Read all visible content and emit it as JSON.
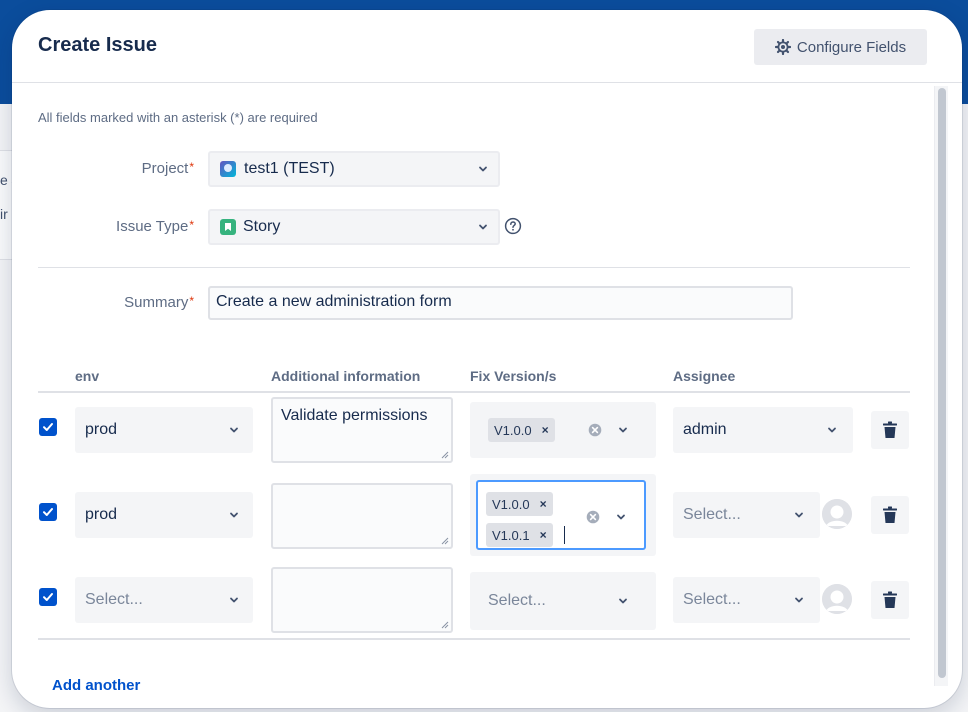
{
  "background": {
    "letter_1": "e J",
    "letter_2": "ir"
  },
  "modal": {
    "title": "Create Issue",
    "configure_label": "Configure Fields",
    "required_note": "All fields marked with an asterisk (*) are required"
  },
  "fields": {
    "project": {
      "label": "Project",
      "value": "test1 (TEST)"
    },
    "issue_type": {
      "label": "Issue Type",
      "value": "Story"
    },
    "summary": {
      "label": "Summary",
      "value": "Create a new administration form"
    },
    "asterisk": "*"
  },
  "table": {
    "headers": {
      "env": "env",
      "additional": "Additional information",
      "fix_versions": "Fix Version/s",
      "assignee": "Assignee"
    },
    "rows": [
      {
        "checked": true,
        "env": "prod",
        "additional": "Validate permissions",
        "fix_versions": [
          "V1.0.0"
        ],
        "assignee": "admin"
      },
      {
        "checked": true,
        "env": "prod",
        "additional": "",
        "fix_versions": [
          "V1.0.0",
          "V1.0.1"
        ],
        "assignee": "Select..."
      },
      {
        "checked": true,
        "env": "Select...",
        "additional": "",
        "fix_versions_placeholder": "Select...",
        "assignee": "Select..."
      }
    ],
    "tag_remove": "×"
  },
  "add_another": "Add another",
  "colors": {
    "primary": "#0052cc",
    "focus": "#4c9aff",
    "required": "#de350b",
    "story": "#36b37e"
  },
  "icons": [
    "gear-icon",
    "chevron-down-icon",
    "help-icon",
    "check-icon",
    "clear-icon",
    "trash-icon",
    "avatar-placeholder-icon",
    "project-icon",
    "story-icon"
  ]
}
